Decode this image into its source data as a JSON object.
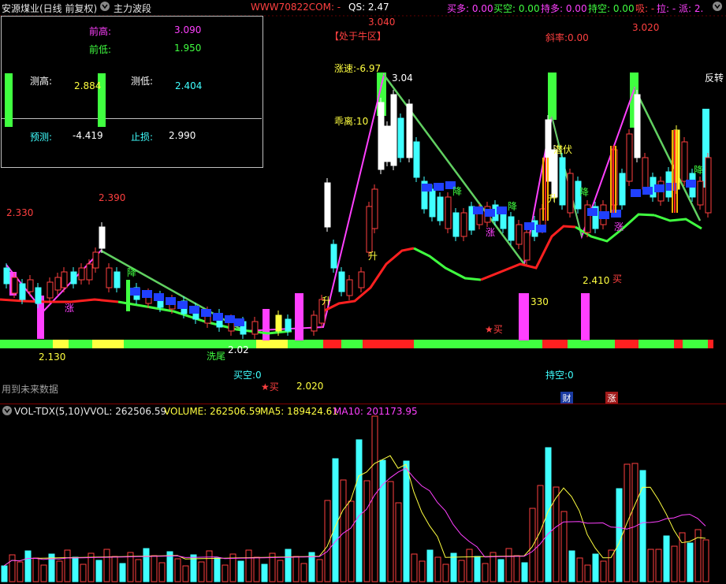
{
  "header": {
    "title": "安源煤业(日线 前复权)",
    "indicator": "主力波段",
    "watermark": "WWW70822COM: -",
    "qs": "QS: 2.47",
    "buy_more": "买多: 0.00",
    "buy_empty": "买空: 0.00",
    "hold_more": "持多: 0.00",
    "hold_empty": "持空: 0.00",
    "absorb": "吸: -",
    "pull": "拉: -",
    "dispatch": "派: 2.",
    "colors": {
      "magenta": "#ff40ff",
      "green": "#40ff40",
      "yellow": "#ffff40",
      "cyan": "#40ffff"
    }
  },
  "info_box": {
    "prev_high_label": "前高:",
    "prev_high": "3.090",
    "prev_low_label": "前低:",
    "prev_low": "1.950",
    "measure_high_label": "测高:",
    "measure_high": "2.884",
    "measure_low_label": "测低:",
    "measure_low": "2.404",
    "forecast_label": "预测:",
    "forecast": "-4.419",
    "stop_label": "止损:",
    "stop": "2.990"
  },
  "annotations": {
    "a1": "3.040",
    "a2": "【处于牛区】",
    "a3": "涨速:-6.97",
    "a4": "3.04",
    "a5": "乖离:10",
    "a6": "斜率:0.00",
    "a7": "3.020",
    "a8": "反转",
    "a9": "2.330",
    "a10": "2.390",
    "a11": "降",
    "a12": "涨",
    "a13": "2.130",
    "a14": "洗尾",
    "a15": "2.02",
    "a16": "买空:0",
    "a17": "★买",
    "a18": "2.020",
    "a19": "用到未来数据",
    "a20": "升",
    "a21": "升",
    "a22": "降",
    "a23": "涨",
    "a24": "降",
    "a25": "★买",
    "a26": "330",
    "a27": "2.410",
    "a28": "买",
    "a29": "持空:0",
    "a30": "潜伏",
    "a31": "降",
    "a32": "涨",
    "a33": "降",
    "a34": "升",
    "a35": "财",
    "a36": "涨"
  },
  "volume": {
    "name": "VOL-TDX(5,10)",
    "vvol": "VVOL: 262506.59",
    "vol": "VOLUME: 262506.59",
    "ma5": "MA5: 189424.61",
    "ma10": "MA10: 201173.95"
  }
}
